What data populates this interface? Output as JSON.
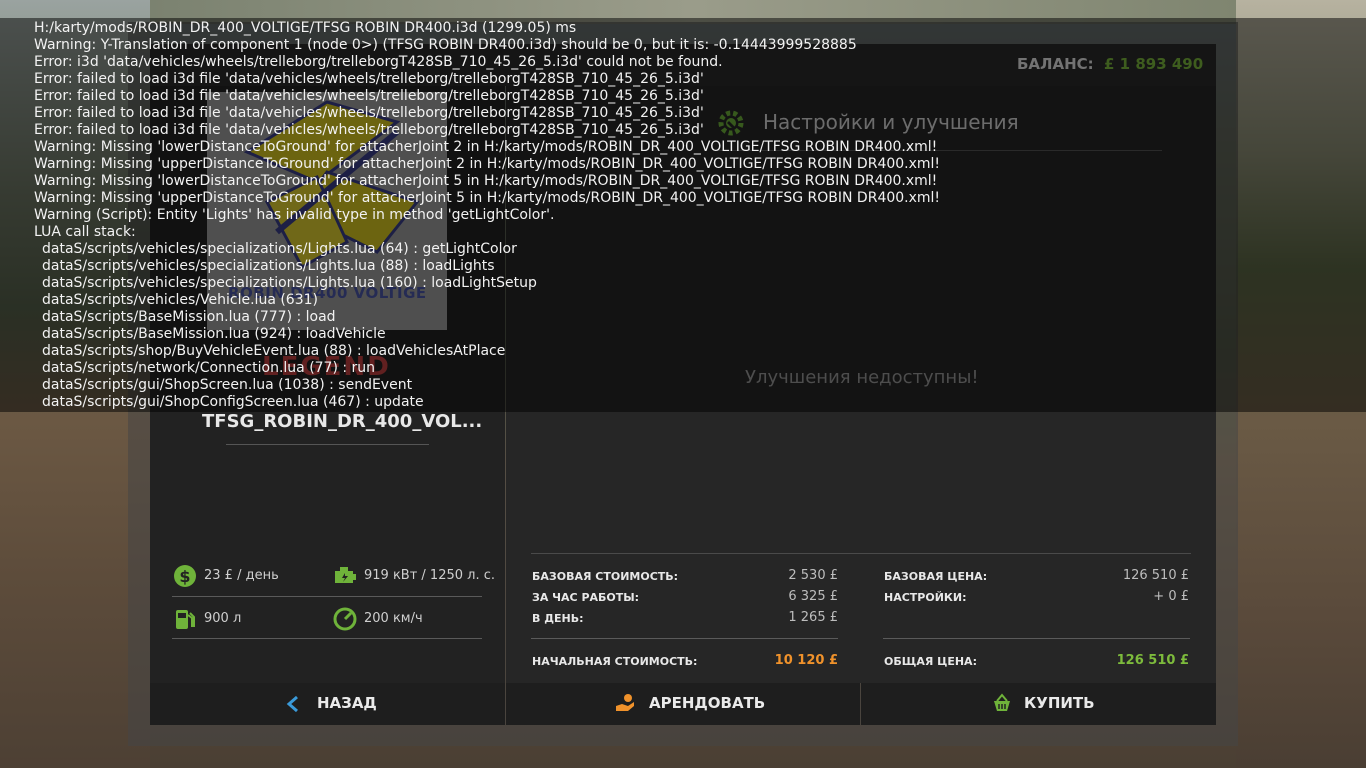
{
  "balance": {
    "label": "БАЛАНС:",
    "value": "£ 1 893 490"
  },
  "config": {
    "title": "Настройки и улучшения",
    "empty_message": "Улучшения недоступны!"
  },
  "vehicle": {
    "name": "TFSG_ROBIN_DR_400_VOL...",
    "thumb_text": "ROBIN DR400 VOLTIGE",
    "legend_text": "LEGEND"
  },
  "specs": {
    "daily_cost": "23 £ / день",
    "power": "919 кВт / 1250 л. с.",
    "fuel": "900 л",
    "speed": "200 км/ч"
  },
  "stats": {
    "base_cost_label": "БАЗОВАЯ СТОИМОСТЬ:",
    "base_cost_value": "2 530 £",
    "per_hour_label": "ЗА ЧАС РАБОТЫ:",
    "per_hour_value": "6 325 £",
    "per_day_label": "В ДЕНЬ:",
    "per_day_value": "1 265 £",
    "initial_cost_label": "НАЧАЛЬНАЯ СТОИМОСТЬ:",
    "initial_cost_value": "10 120 £",
    "base_price_label": "БАЗОВАЯ ЦЕНА:",
    "base_price_value": "126 510 £",
    "settings_label": "НАСТРОЙКИ:",
    "settings_value": "+ 0 £",
    "total_price_label": "ОБЩАЯ ЦЕНА:",
    "total_price_value": "126 510 £"
  },
  "buttons": {
    "back": "НАЗАД",
    "lease": "АРЕНДОВАТЬ",
    "buy": "КУПИТЬ"
  },
  "colors": {
    "accent_green": "#7dbb3c",
    "accent_orange": "#f0922b",
    "back_blue": "#3a9ad9"
  },
  "log": [
    "H:/karty/mods/ROBIN_DR_400_VOLTIGE/TFSG ROBIN DR400.i3d (1299.05) ms",
    "Warning: Y-Translation of component 1 (node 0>) (TFSG ROBIN DR400.i3d) should be 0, but it is: -0.14443999528885",
    "Error: i3d  'data/vehicles/wheels/trelleborg/trelleborgT428SB_710_45_26_5.i3d' could not be found.",
    "Error: failed to load i3d file 'data/vehicles/wheels/trelleborg/trelleborgT428SB_710_45_26_5.i3d'",
    "Error: failed to load i3d file 'data/vehicles/wheels/trelleborg/trelleborgT428SB_710_45_26_5.i3d'",
    "Error: failed to load i3d file 'data/vehicles/wheels/trelleborg/trelleborgT428SB_710_45_26_5.i3d'",
    "Error: failed to load i3d file 'data/vehicles/wheels/trelleborg/trelleborgT428SB_710_45_26_5.i3d'",
    "Warning: Missing 'lowerDistanceToGround' for attacherJoint 2 in H:/karty/mods/ROBIN_DR_400_VOLTIGE/TFSG ROBIN DR400.xml!",
    "Warning: Missing 'upperDistanceToGround' for attacherJoint 2 in H:/karty/mods/ROBIN_DR_400_VOLTIGE/TFSG ROBIN DR400.xml!",
    "Warning: Missing 'lowerDistanceToGround' for attacherJoint 5 in H:/karty/mods/ROBIN_DR_400_VOLTIGE/TFSG ROBIN DR400.xml!",
    "Warning: Missing 'upperDistanceToGround' for attacherJoint 5 in H:/karty/mods/ROBIN_DR_400_VOLTIGE/TFSG ROBIN DR400.xml!",
    "Warning (Script): Entity 'Lights' has invalid type in method 'getLightColor'.",
    "LUA call stack:",
    "dataS/scripts/vehicles/specializations/Lights.lua (64) : getLightColor",
    "dataS/scripts/vehicles/specializations/Lights.lua (88) : loadLights",
    "dataS/scripts/vehicles/specializations/Lights.lua (160) : loadLightSetup",
    "dataS/scripts/vehicles/Vehicle.lua (631)",
    "dataS/scripts/BaseMission.lua (777) : load",
    "dataS/scripts/BaseMission.lua (924) : loadVehicle",
    "dataS/scripts/shop/BuyVehicleEvent.lua (88) : loadVehiclesAtPlace",
    "dataS/scripts/network/Connection.lua (77) : run",
    "dataS/scripts/gui/ShopScreen.lua (1038) : sendEvent",
    "dataS/scripts/gui/ShopConfigScreen.lua (467) : update"
  ]
}
